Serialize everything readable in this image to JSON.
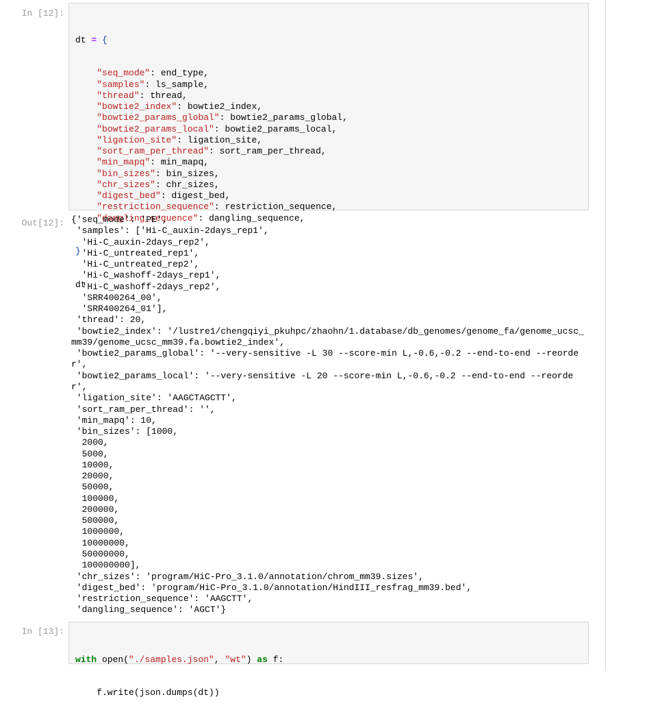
{
  "cells": [
    {
      "in_prompt": "In [12]:",
      "out_prompt": "Out[12]:",
      "code": {
        "var": "dt",
        "assign": "=",
        "open": "{",
        "entries": [
          {
            "key": "\"seq_mode\"",
            "value": "end_type,"
          },
          {
            "key": "\"samples\"",
            "value": "ls_sample,"
          },
          {
            "key": "\"thread\"",
            "value": "thread,"
          },
          {
            "key": "\"bowtie2_index\"",
            "value": "bowtie2_index,"
          },
          {
            "key": "\"bowtie2_params_global\"",
            "value": "bowtie2_params_global,"
          },
          {
            "key": "\"bowtie2_params_local\"",
            "value": "bowtie2_params_local,"
          },
          {
            "key": "\"ligation_site\"",
            "value": "ligation_site,"
          },
          {
            "key": "\"sort_ram_per_thread\"",
            "value": "sort_ram_per_thread,"
          },
          {
            "key": "\"min_mapq\"",
            "value": "min_mapq,"
          },
          {
            "key": "\"bin_sizes\"",
            "value": "bin_sizes,"
          },
          {
            "key": "\"chr_sizes\"",
            "value": "chr_sizes,"
          },
          {
            "key": "\"digest_bed\"",
            "value": "digest_bed,"
          },
          {
            "key": "\"restriction_sequence\"",
            "value": "restriction_sequence,"
          },
          {
            "key": "\"dangling_sequence\"",
            "value": "dangling_sequence,"
          }
        ],
        "close": "}",
        "last": "dt"
      },
      "output_lines": [
        "{'seq_mode': 'PE',",
        " 'samples': ['Hi-C_auxin-2days_rep1',",
        "  'Hi-C_auxin-2days_rep2',",
        "  'Hi-C_untreated_rep1',",
        "  'Hi-C_untreated_rep2',",
        "  'Hi-C_washoff-2days_rep1',",
        "  'Hi-C_washoff-2days_rep2',",
        "  'SRR400264_00',",
        "  'SRR400264_01'],",
        " 'thread': 20,",
        " 'bowtie2_index': '/lustre1/chengqiyi_pkuhpc/zhaohn/1.database/db_genomes/genome_fa/genome_ucsc_",
        "mm39/genome_ucsc_mm39.fa.bowtie2_index',",
        " 'bowtie2_params_global': '--very-sensitive -L 30 --score-min L,-0.6,-0.2 --end-to-end --reorde",
        "r',",
        " 'bowtie2_params_local': '--very-sensitive -L 20 --score-min L,-0.6,-0.2 --end-to-end --reorde",
        "r',",
        " 'ligation_site': 'AAGCTAGCTT',",
        " 'sort_ram_per_thread': '',",
        " 'min_mapq': 10,",
        " 'bin_sizes': [1000,",
        "  2000,",
        "  5000,",
        "  10000,",
        "  20000,",
        "  50000,",
        "  100000,",
        "  200000,",
        "  500000,",
        "  1000000,",
        "  10000000,",
        "  50000000,",
        "  100000000],",
        " 'chr_sizes': 'program/HiC-Pro_3.1.0/annotation/chrom_mm39.sizes',",
        " 'digest_bed': 'program/HiC-Pro_3.1.0/annotation/HindIII_resfrag_mm39.bed',",
        " 'restriction_sequence': 'AAGCTT',",
        " 'dangling_sequence': 'AGCT'}"
      ]
    },
    {
      "in_prompt": "In [13]:",
      "code2": {
        "kw_with": "with",
        "open_call": " open(",
        "path": "\"./samples.json\"",
        "comma": ", ",
        "mode": "\"wt\"",
        "close_paren": ") ",
        "kw_as": "as",
        "tail": " f:",
        "line2": "    f.write(json.dumps(dt))"
      }
    }
  ]
}
